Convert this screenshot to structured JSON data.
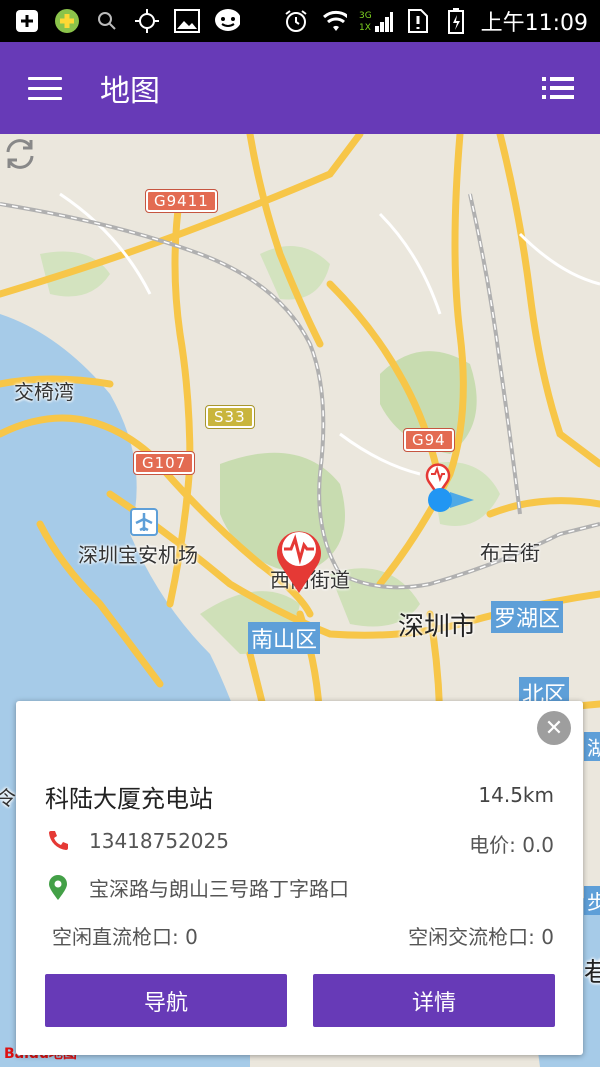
{
  "status_bar": {
    "network_type": "3G/1X",
    "time": "上午11:09"
  },
  "app_bar": {
    "title": "地图"
  },
  "map": {
    "labels": {
      "jiaoyiwan": "交椅湾",
      "airport": "深圳宝安机场",
      "xili": "西丽街道",
      "shenzhen": "深圳市",
      "bujijie": "布吉街",
      "nanshan": "南山区",
      "luohu": "罗湖区",
      "futian_north": "北区",
      "left_edge": "令",
      "right_edge_1": "湖",
      "right_edge_2": "步",
      "right_edge_3": "巷"
    },
    "highways": {
      "g9411": "G9411",
      "s33": "S33",
      "g107": "G107",
      "g94": "G94"
    },
    "logo": "Baidu地图"
  },
  "station_card": {
    "name": "科陆大厦充电站",
    "distance": "14.5km",
    "phone": "13418752025",
    "price": "电价: 0.0",
    "address": "宝深路与朗山三号路丁字路口",
    "dc_ports": "空闲直流枪口: 0",
    "ac_ports": "空闲交流枪口: 0",
    "navigate_label": "导航",
    "details_label": "详情"
  },
  "colors": {
    "primary": "#673ab7",
    "pin_red": "#e53935",
    "phone_icon": "#e53935",
    "location_icon": "#43a047",
    "water": "#a6cbe8",
    "road": "#f7c648"
  }
}
